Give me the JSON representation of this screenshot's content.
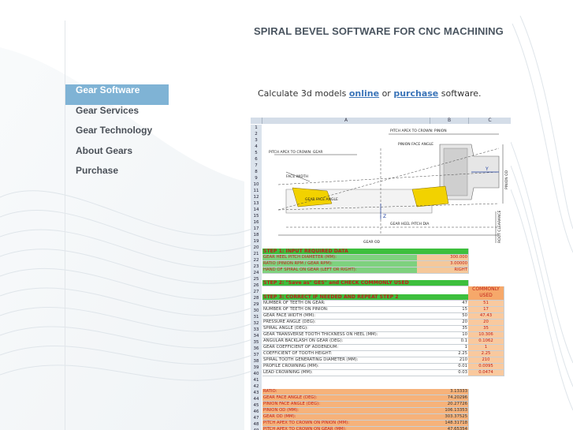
{
  "page_title": "SPIRAL BEVEL SOFTWARE FOR CNC MACHINING",
  "nav": [
    {
      "label": "Gear Software",
      "active": true
    },
    {
      "label": "Gear Services",
      "active": false
    },
    {
      "label": "Gear Technology",
      "active": false
    },
    {
      "label": "About Gears",
      "active": false
    },
    {
      "label": "Purchase",
      "active": false
    }
  ],
  "intro": {
    "prefix": "Calculate 3d models",
    "link1": "online",
    "middle": "or",
    "link2": "purchase",
    "suffix": "software."
  },
  "spreadsheet": {
    "columns": [
      "A",
      "B",
      "C"
    ],
    "diagram_labels": {
      "pitch_apex_to_crown_pinion": "PITCH APEX TO CROWN: PINION",
      "pinion_face_angle": "PINION FACE ANGLE",
      "pitch_apex_to_crown_gear": "PITCH APEX TO CROWN: GEAR",
      "face_width": "FACE WIDTH",
      "gear_face_angle": "GEAR FACE ANGLE",
      "gear_heel_pitch_dia": "GEAR HEEL PITCH DIA",
      "gear_od": "GEAR OD",
      "pinion_od": "PINION OD",
      "root_clearance": "ROOT CLEARANCE",
      "axis_y": "Y",
      "axis_z": "Z"
    },
    "step1_header": "STEP 1: INPUT REQUIRED DATA",
    "step1_rows": [
      {
        "label": "GEAR HEEL PITCH DIAMETER (MM):",
        "value": "300.000"
      },
      {
        "label": "RATIO (PINION RPM / GEAR RPM):",
        "value": "3.00000"
      },
      {
        "label": "HAND OF SPIRAL ON GEAR (LEFT OR RIGHT):",
        "value": "RIGHT"
      }
    ],
    "step2_header": "STEP 2: \"Save as\" GES\" and CHECK COMMONLY USED",
    "step3_header": "STEP 3: CORRECT IF NEEDED AND REPEAT STEP 2",
    "commonly_used_label": "COMMONLY USED",
    "step3_rows": [
      {
        "label": "NUMBER OF TEETH ON GEAR:",
        "value": "47",
        "used": "51"
      },
      {
        "label": "NUMBER OF TEETH ON PINION:",
        "value": "15",
        "used": "17"
      },
      {
        "label": "GEAR FACE WIDTH (MM):",
        "value": "50",
        "used": "47.43"
      },
      {
        "label": "PRESSURE ANGLE (DEG):",
        "value": "20",
        "used": "20"
      },
      {
        "label": "SPIRAL ANGLE (DEG):",
        "value": "35",
        "used": "35"
      },
      {
        "label": "GEAR TRANSVERSE TOOTH THICKNESS ON HEEL (MM):",
        "value": "10",
        "used": "10.306"
      },
      {
        "label": "ANGULAR BACKLASH ON GEAR (DEG):",
        "value": "0.1",
        "used": "0.1062"
      },
      {
        "label": "GEAR COEFFICIENT OF ADDENDUM:",
        "value": "1",
        "used": "1"
      },
      {
        "label": "COEFFICIENT OF TOOTH HEIGHT:",
        "value": "2.25",
        "used": "2.25"
      },
      {
        "label": "SPIRAL TOOTH GENERATING DIAMETER (MM):",
        "value": "210",
        "used": "210"
      },
      {
        "label": "PROFILE CROWNING (MM):",
        "value": "0.01",
        "used": "0.0095"
      },
      {
        "label": "LEAD CROWNING (MM):",
        "value": "0.03",
        "used": "0.0474"
      }
    ],
    "results": [
      {
        "label": "RATIO:",
        "value": "3.13333"
      },
      {
        "label": "GEAR FACE ANGLE (DEG):",
        "value": "74.20296"
      },
      {
        "label": "PINION FACE ANGLE (DEG):",
        "value": "20.27726"
      },
      {
        "label": "PINION OD (MM):",
        "value": "106.13353"
      },
      {
        "label": "GEAR OD (MM):",
        "value": "303.37525"
      },
      {
        "label": "PITCH APEX TO CROWN ON PINION (MM):",
        "value": "148.31718"
      },
      {
        "label": "PITCH APEX TO CROWN ON GEAR (MM):",
        "value": "47.65354"
      }
    ]
  }
}
